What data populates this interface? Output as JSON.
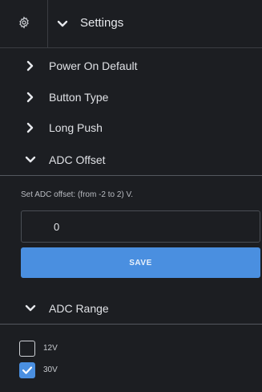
{
  "header": {
    "title": "Settings",
    "gear_icon": "gear-icon",
    "toggle_icon": "chevron-down-icon"
  },
  "sections": [
    {
      "label": "Power On Default",
      "expanded": false
    },
    {
      "label": "Button Type",
      "expanded": false
    },
    {
      "label": "Long Push",
      "expanded": false
    },
    {
      "label": "ADC Offset",
      "expanded": true
    },
    {
      "label": "ADC Range",
      "expanded": true
    }
  ],
  "adc_offset": {
    "help_text": "Set ADC offset: (from -2 to 2) V.",
    "value": "0",
    "save_label": "SAVE"
  },
  "adc_range": {
    "options": [
      {
        "label": "12V",
        "checked": false
      },
      {
        "label": "30V",
        "checked": true
      }
    ]
  },
  "colors": {
    "background": "#1c1e22",
    "accent": "#4a8fe0",
    "text": "#e2e4e8"
  }
}
